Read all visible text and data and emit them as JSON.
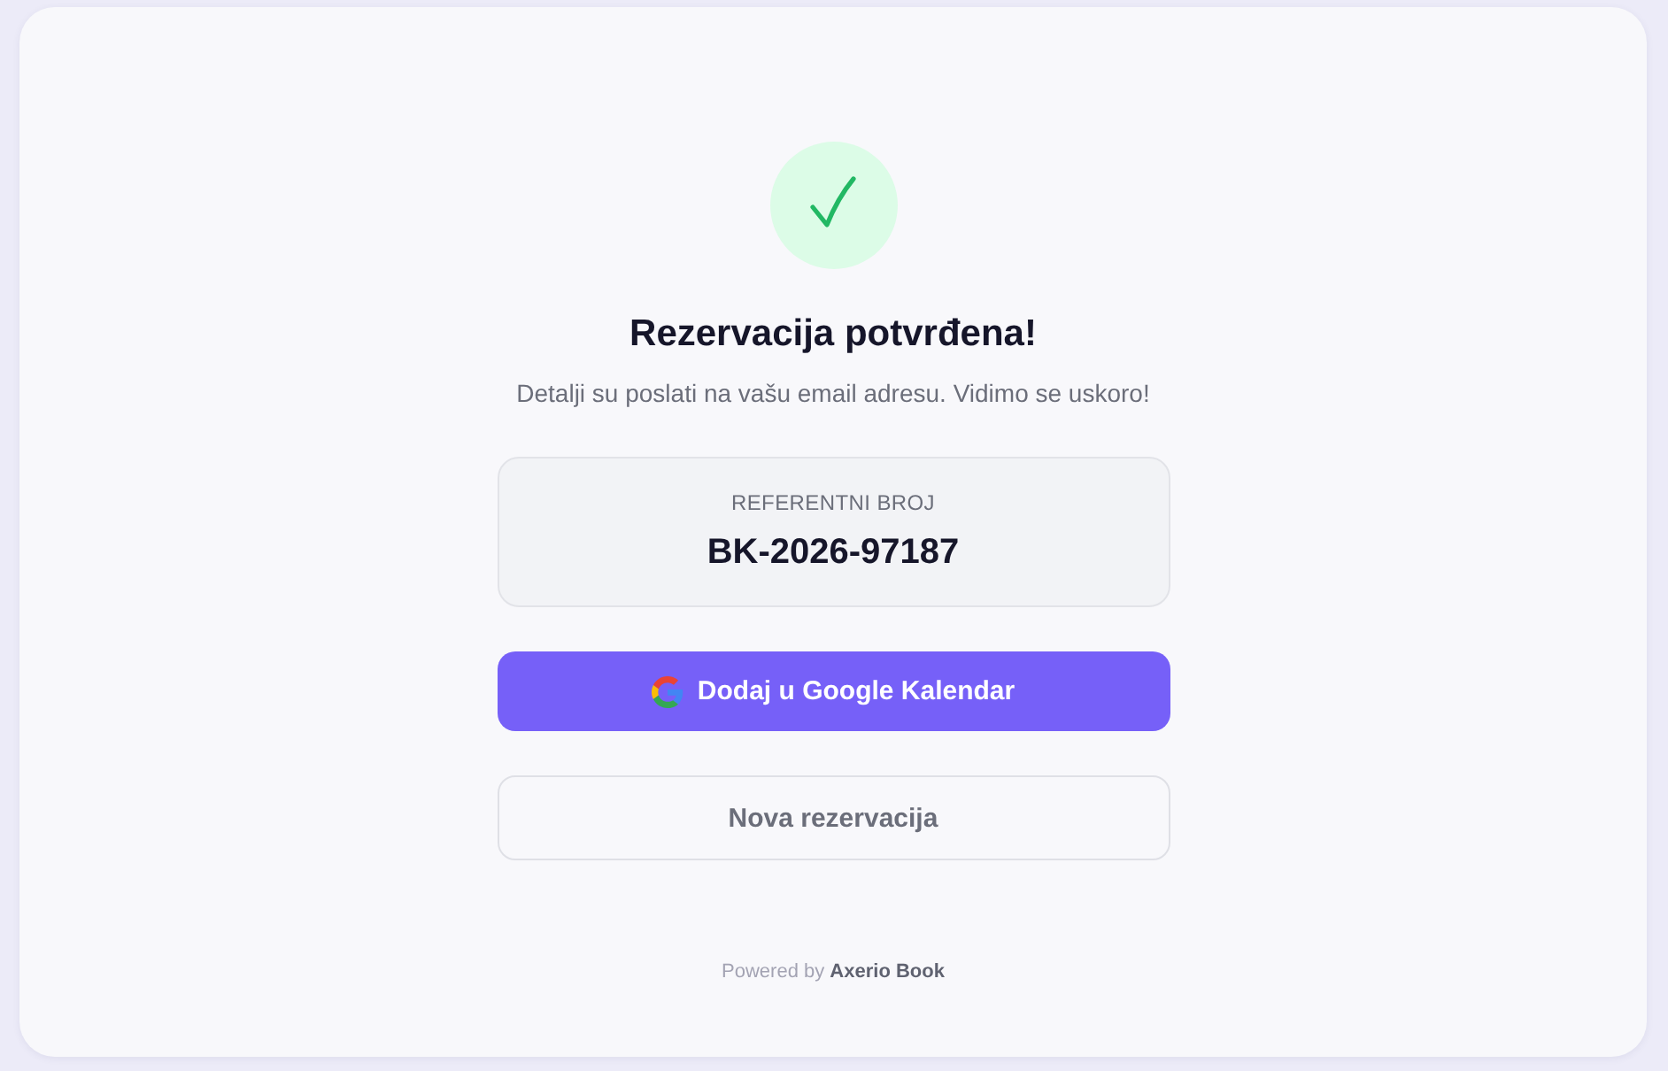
{
  "confirmation": {
    "title": "Rezervacija potvrđena!",
    "message": "Detalji su poslati na vašu email adresu. Vidimo se uskoro!"
  },
  "reference": {
    "label": "REFERENTNI BROJ",
    "value": "BK-2026-97187"
  },
  "actions": [
    {
      "kind": "primary",
      "label": "Dodaj u Google Kalendar"
    },
    {
      "kind": "secondary",
      "label": "Nova rezervacija"
    }
  ],
  "footer": {
    "text": "Powered by **Axerio Book**"
  }
}
